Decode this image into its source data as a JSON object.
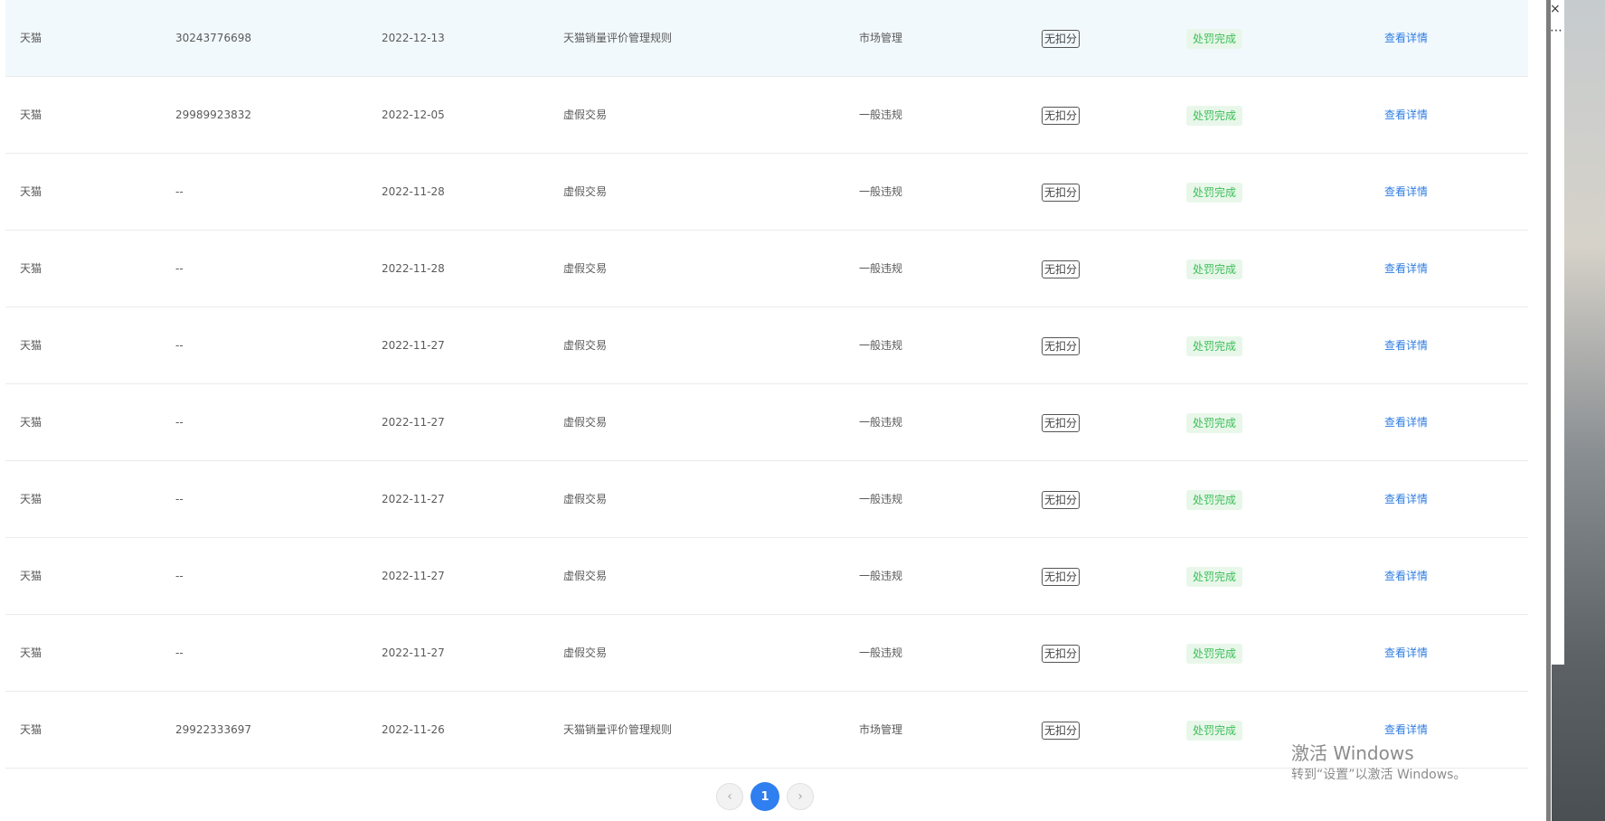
{
  "table": {
    "rows": [
      {
        "platform": "天猫",
        "id": "30243776698",
        "date": "2022-12-13",
        "rule": "天猫销量评价管理规则",
        "type": "市场管理",
        "score": "无扣分",
        "status": "处罚完成",
        "action": "查看详情"
      },
      {
        "platform": "天猫",
        "id": "29989923832",
        "date": "2022-12-05",
        "rule": "虚假交易",
        "type": "一般违规",
        "score": "无扣分",
        "status": "处罚完成",
        "action": "查看详情"
      },
      {
        "platform": "天猫",
        "id": "--",
        "date": "2022-11-28",
        "rule": "虚假交易",
        "type": "一般违规",
        "score": "无扣分",
        "status": "处罚完成",
        "action": "查看详情"
      },
      {
        "platform": "天猫",
        "id": "--",
        "date": "2022-11-28",
        "rule": "虚假交易",
        "type": "一般违规",
        "score": "无扣分",
        "status": "处罚完成",
        "action": "查看详情"
      },
      {
        "platform": "天猫",
        "id": "--",
        "date": "2022-11-27",
        "rule": "虚假交易",
        "type": "一般违规",
        "score": "无扣分",
        "status": "处罚完成",
        "action": "查看详情"
      },
      {
        "platform": "天猫",
        "id": "--",
        "date": "2022-11-27",
        "rule": "虚假交易",
        "type": "一般违规",
        "score": "无扣分",
        "status": "处罚完成",
        "action": "查看详情"
      },
      {
        "platform": "天猫",
        "id": "--",
        "date": "2022-11-27",
        "rule": "虚假交易",
        "type": "一般违规",
        "score": "无扣分",
        "status": "处罚完成",
        "action": "查看详情"
      },
      {
        "platform": "天猫",
        "id": "--",
        "date": "2022-11-27",
        "rule": "虚假交易",
        "type": "一般违规",
        "score": "无扣分",
        "status": "处罚完成",
        "action": "查看详情"
      },
      {
        "platform": "天猫",
        "id": "--",
        "date": "2022-11-27",
        "rule": "虚假交易",
        "type": "一般违规",
        "score": "无扣分",
        "status": "处罚完成",
        "action": "查看详情"
      },
      {
        "platform": "天猫",
        "id": "29922333697",
        "date": "2022-11-26",
        "rule": "天猫销量评价管理规则",
        "type": "市场管理",
        "score": "无扣分",
        "status": "处罚完成",
        "action": "查看详情"
      }
    ]
  },
  "pagination": {
    "prev_icon": "chevron-left-icon",
    "current_page": "1",
    "next_icon": "chevron-right-icon"
  },
  "window": {
    "close_glyph": "×",
    "more_glyph": "⋯"
  },
  "watermark": {
    "title": "激活 Windows",
    "subtitle": "转到“设置”以激活 Windows。"
  },
  "colors": {
    "link": "#2f7de1",
    "success_text": "#3cbf58",
    "success_bg": "#e8f7ea",
    "highlight_row": "#f2f9fd",
    "active_page": "#2f7ff0"
  }
}
